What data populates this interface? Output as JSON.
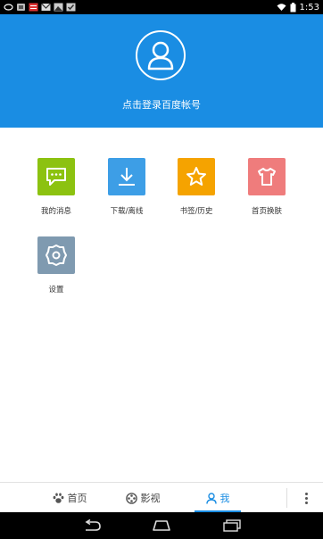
{
  "status_bar": {
    "time": "1:53",
    "left_icons": [
      "notification-icon",
      "app-icon",
      "news-icon",
      "gmail-icon",
      "image-icon",
      "check-icon"
    ],
    "right_icons": [
      "wifi-icon",
      "battery-icon"
    ]
  },
  "header": {
    "login_text": "点击登录百度帐号",
    "avatar_icon": "user-icon"
  },
  "grid": [
    {
      "label": "我的消息",
      "icon": "message-icon",
      "color": "#8cc210"
    },
    {
      "label": "下载/离线",
      "icon": "download-icon",
      "color": "#3d9ee6"
    },
    {
      "label": "书签/历史",
      "icon": "star-icon",
      "color": "#f5a300"
    },
    {
      "label": "首页换肤",
      "icon": "tshirt-icon",
      "color": "#ef7c7c"
    },
    {
      "label": "设置",
      "icon": "settings-icon",
      "color": "#7f9ab0"
    }
  ],
  "tabs": [
    {
      "label": "首页",
      "icon": "paw-icon",
      "active": false
    },
    {
      "label": "影视",
      "icon": "film-reel-icon",
      "active": false
    },
    {
      "label": "我",
      "icon": "person-icon",
      "active": true
    }
  ],
  "colors": {
    "accent": "#1a8de3"
  }
}
